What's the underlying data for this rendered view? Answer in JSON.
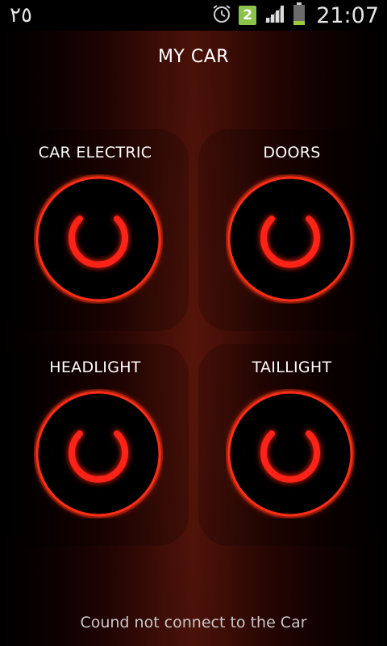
{
  "status_bar": {
    "left_text": "٢٥",
    "notification_count": "2",
    "time": "21:07"
  },
  "app": {
    "title": "MY CAR",
    "status_message": "Cound not connect to the Car"
  },
  "controls": [
    {
      "label": "CAR ELECTRIC"
    },
    {
      "label": "DOORS"
    },
    {
      "label": "HEADLIGHT"
    },
    {
      "label": "TAILLIGHT"
    }
  ],
  "colors": {
    "accent": "#ff2a12",
    "background": "#000000"
  }
}
